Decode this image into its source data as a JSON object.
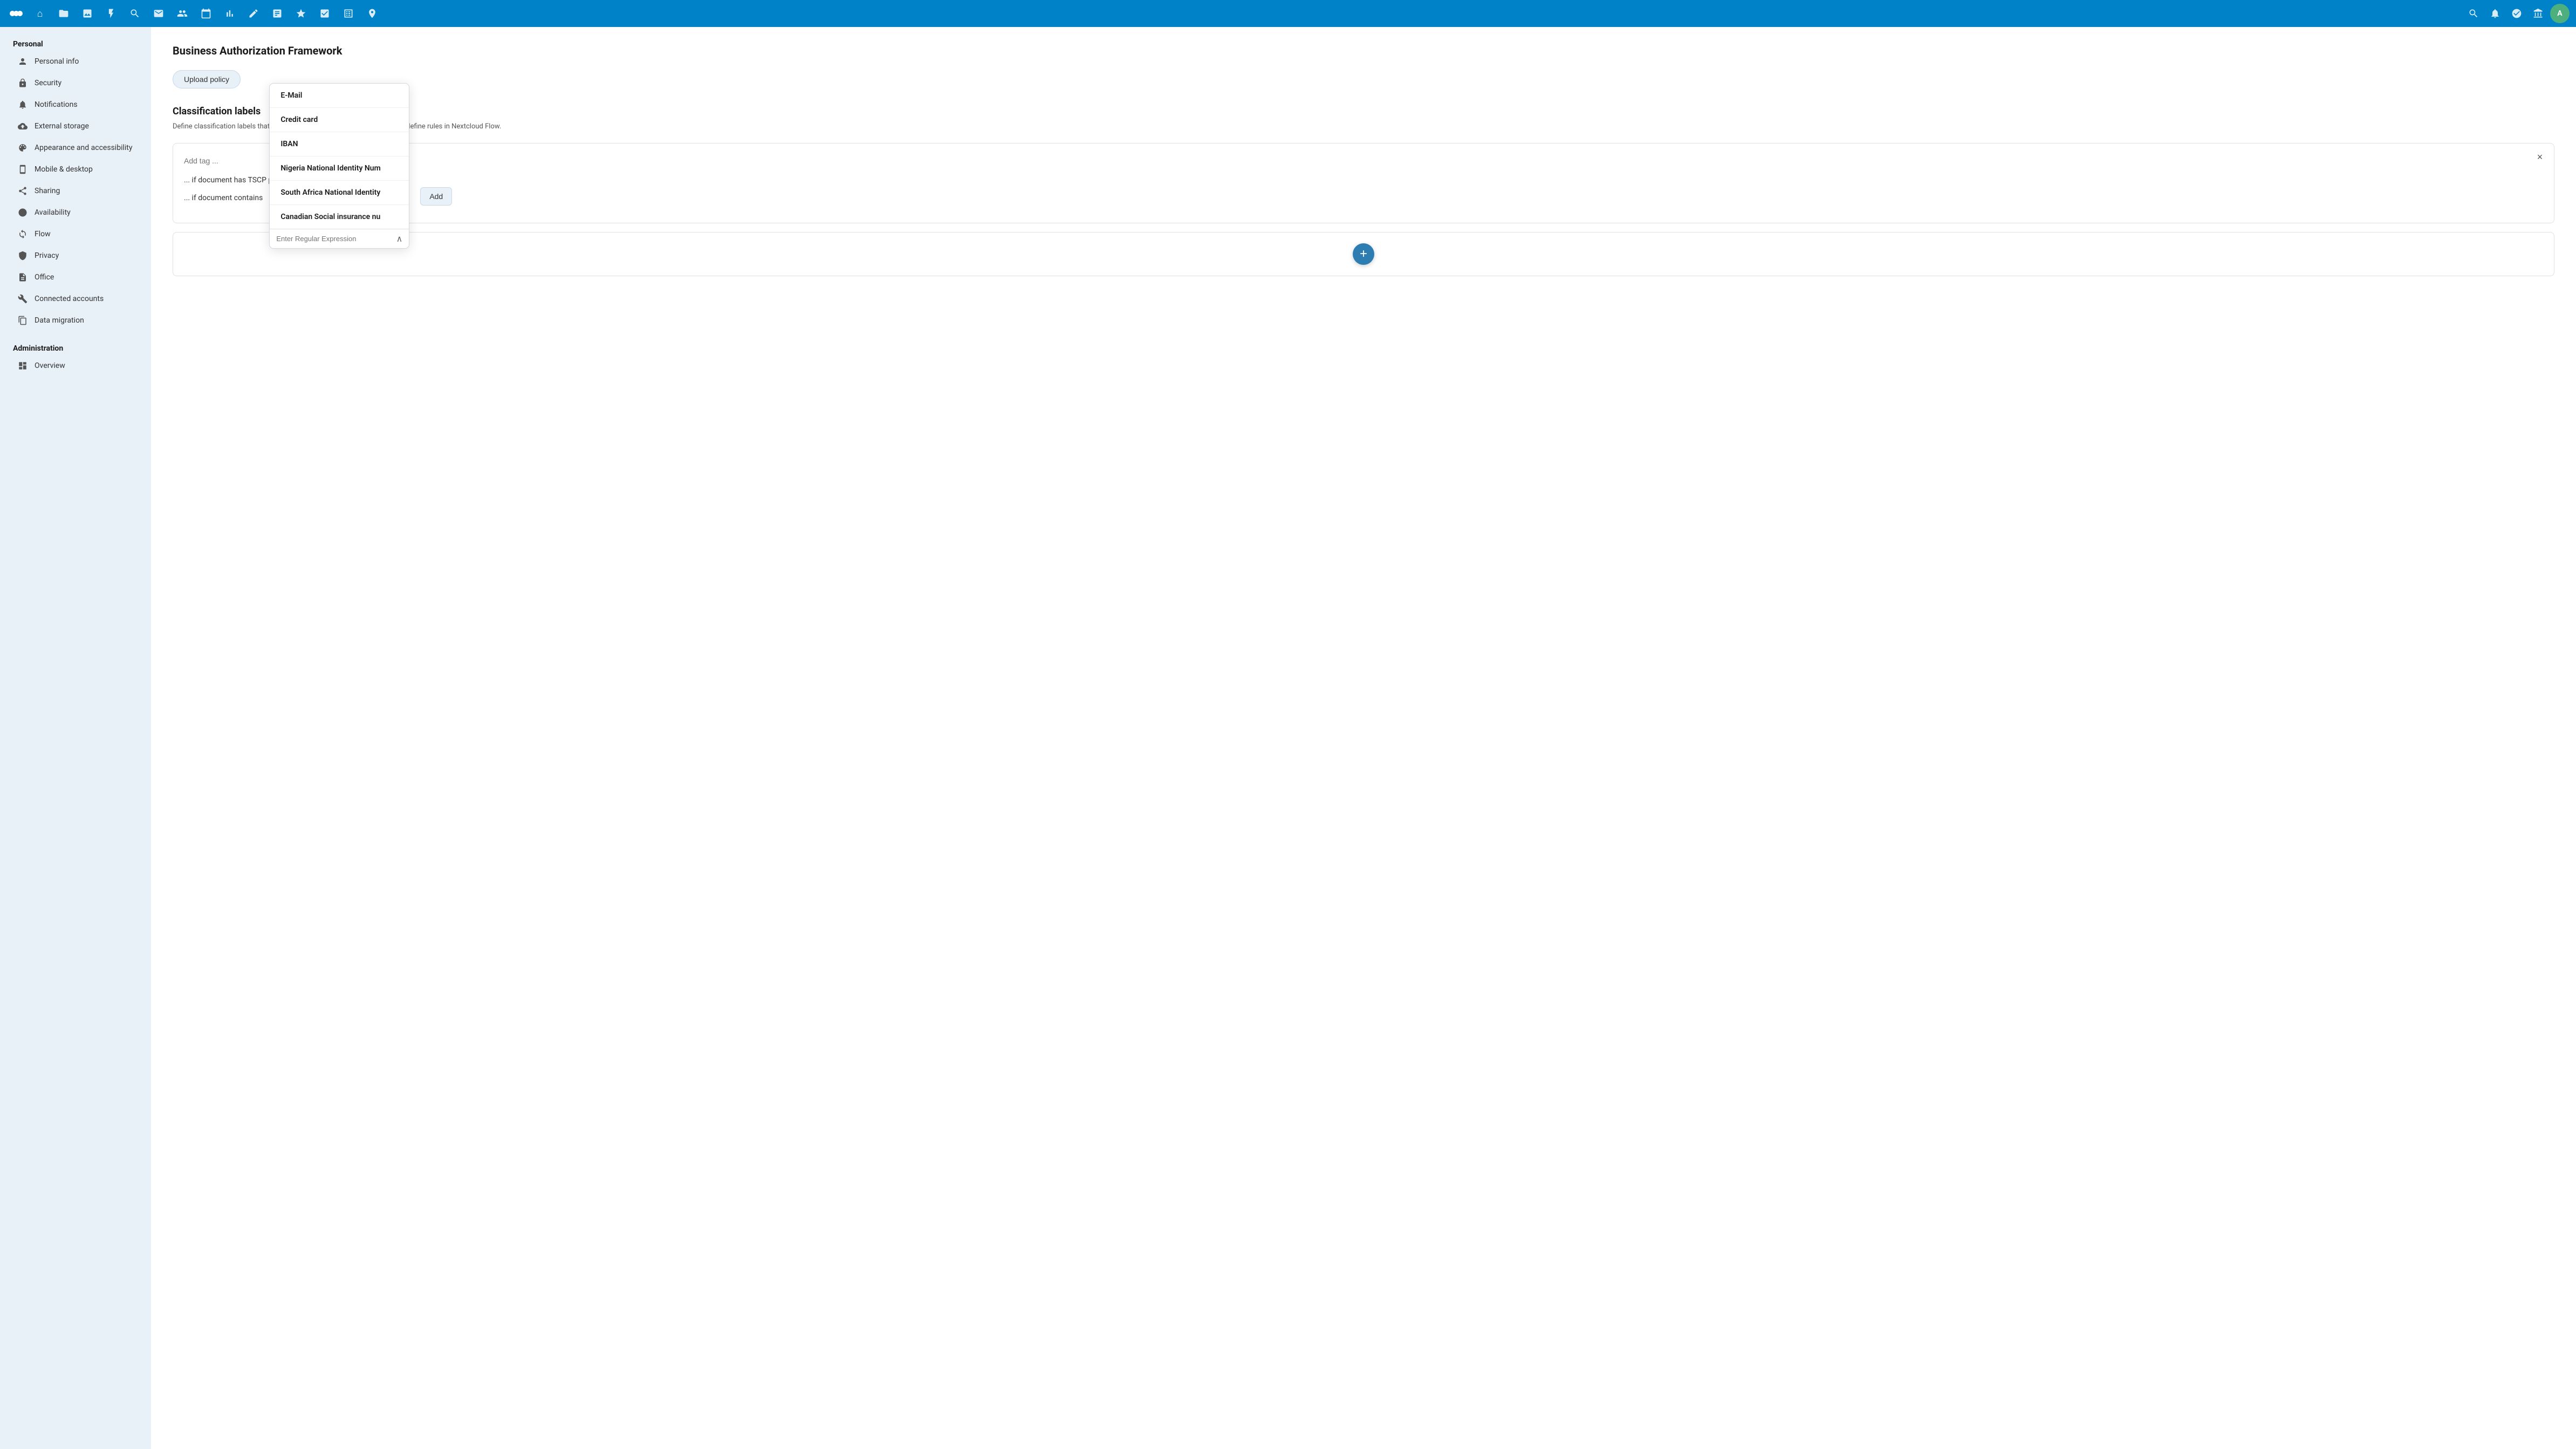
{
  "navbar": {
    "icons": [
      {
        "name": "home-icon",
        "glyph": "⌂"
      },
      {
        "name": "files-icon",
        "glyph": "📁"
      },
      {
        "name": "photos-icon",
        "glyph": "🖼"
      },
      {
        "name": "activity-icon",
        "glyph": "⚡"
      },
      {
        "name": "search-icon",
        "glyph": "🔍"
      },
      {
        "name": "mail-icon",
        "glyph": "✉"
      },
      {
        "name": "contacts-icon",
        "glyph": "👥"
      },
      {
        "name": "calendar-icon",
        "glyph": "📅"
      },
      {
        "name": "charts-icon",
        "glyph": "📊"
      },
      {
        "name": "notes-icon",
        "glyph": "✏"
      },
      {
        "name": "deck-icon",
        "glyph": "🗂"
      },
      {
        "name": "starred-icon",
        "glyph": "⭐"
      },
      {
        "name": "tasks-icon",
        "glyph": "☑"
      },
      {
        "name": "checklist-icon",
        "glyph": "✓"
      },
      {
        "name": "table-icon",
        "glyph": "⊞"
      },
      {
        "name": "maps-icon",
        "glyph": "📍"
      }
    ],
    "right_icons": [
      {
        "name": "search-right-icon",
        "glyph": "🔍"
      },
      {
        "name": "notifications-icon",
        "glyph": "🔔"
      },
      {
        "name": "user-status-icon",
        "glyph": "👤"
      },
      {
        "name": "apps-icon",
        "glyph": "⊞"
      }
    ],
    "avatar_label": "A"
  },
  "sidebar": {
    "personal_section": "Personal",
    "admin_section": "Administration",
    "items": [
      {
        "id": "personal-info",
        "label": "Personal info",
        "icon": "👤"
      },
      {
        "id": "security",
        "label": "Security",
        "icon": "🔒"
      },
      {
        "id": "notifications",
        "label": "Notifications",
        "icon": "🔔"
      },
      {
        "id": "external-storage",
        "label": "External storage",
        "icon": "📤"
      },
      {
        "id": "appearance",
        "label": "Appearance and accessibility",
        "icon": "🎨"
      },
      {
        "id": "mobile",
        "label": "Mobile & desktop",
        "icon": "📱"
      },
      {
        "id": "sharing",
        "label": "Sharing",
        "icon": "↗"
      },
      {
        "id": "availability",
        "label": "Availability",
        "icon": "🕐"
      },
      {
        "id": "flow",
        "label": "Flow",
        "icon": "⟳"
      },
      {
        "id": "privacy",
        "label": "Privacy",
        "icon": "🔐"
      },
      {
        "id": "office",
        "label": "Office",
        "icon": "📄"
      },
      {
        "id": "connected-accounts",
        "label": "Connected accounts",
        "icon": "🔧"
      },
      {
        "id": "data-migration",
        "label": "Data migration",
        "icon": "💾"
      }
    ],
    "admin_items": [
      {
        "id": "overview",
        "label": "Overview",
        "icon": "⊞"
      }
    ]
  },
  "content": {
    "page_title": "Business Authorization Framework",
    "upload_policy_btn": "Upload policy",
    "classification": {
      "title": "Classification labels",
      "description": "Define classification labels that apply to different documents. You can also define rules in Nextcloud Flow.",
      "add_tag_placeholder": "Add tag ...",
      "condition1": "... if document has TSCP policy category ID",
      "condition2": "... if document contains",
      "close_label": "×"
    },
    "dropdown": {
      "items": [
        {
          "label": "E-Mail"
        },
        {
          "label": "Credit card"
        },
        {
          "label": "IBAN"
        },
        {
          "label": "Nigeria National Identity Num"
        },
        {
          "label": "South Africa National Identity"
        },
        {
          "label": "Canadian Social insurance nu"
        }
      ],
      "regex_placeholder": "Enter Regular Expression",
      "add_btn": "Add"
    },
    "add_btn_label": "+"
  }
}
